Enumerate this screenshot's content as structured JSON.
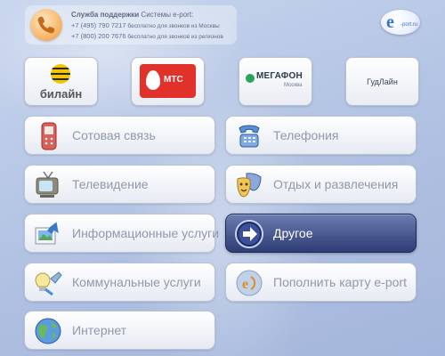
{
  "support": {
    "title_bold": "Служба поддержки",
    "title_rest": "Системы e-port:",
    "line1_num": "+7 (495) 790 7217",
    "line1_text": "бесплатно для звонков из Москвы",
    "line2_num": "+7 (800) 200 7676",
    "line2_text": "бесплатно для звонков из регионов"
  },
  "logo": {
    "letter": "e",
    "text": "-port.ru"
  },
  "operators": [
    {
      "name": "beeline",
      "label": "билайн"
    },
    {
      "name": "mts",
      "label": "МТС"
    },
    {
      "name": "megafon",
      "label": "МЕГАФОН",
      "sublabel": "Москва"
    },
    {
      "name": "gudline",
      "label": "ГудЛайн"
    }
  ],
  "categories": {
    "left": [
      {
        "label": "Сотовая связь",
        "icon": "mobile-phone-icon"
      },
      {
        "label": "Телевидение",
        "icon": "tv-icon"
      },
      {
        "label": "Информационные услуги",
        "icon": "info-services-icon"
      },
      {
        "label": "Коммунальные услуги",
        "icon": "utilities-icon"
      },
      {
        "label": "Интернет",
        "icon": "globe-icon"
      }
    ],
    "right": [
      {
        "label": "Телефония",
        "icon": "telephone-icon"
      },
      {
        "label": "Отдых и развлечения",
        "icon": "theater-masks-icon"
      },
      {
        "label": "Другое",
        "icon": "arrow-right-icon",
        "active": true
      },
      {
        "label": "Пополнить карту e-port",
        "icon": "eport-card-icon"
      }
    ]
  },
  "colors": {
    "active_button": "#2e3d75",
    "accent": "#3a6fcf",
    "mts_red": "#e2312a",
    "beeline_yellow": "#f5c400"
  }
}
